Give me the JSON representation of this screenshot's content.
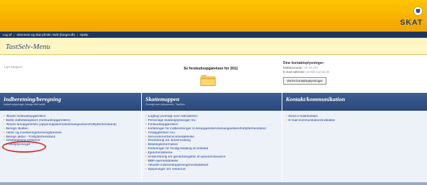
{
  "header": {
    "logo_text": "SKAT",
    "crown_icon": "crown-icon",
    "nav": [
      "Log af",
      "Abonnent og skat på Min Side (borger.dk)",
      "Hjælp"
    ]
  },
  "page_title": "TastSelv-Menu",
  "user": {
    "name": "Lars Mogens"
  },
  "forskud": {
    "label": "Se forskudsopgørelsen for 2011",
    "icon": "folder-icon"
  },
  "contact": {
    "heading": "Dine kontaktoplysninger:",
    "mobile_label": "Mobilnummer:",
    "mobile_value": "20 18 262",
    "email_label": "E-mail adresse:",
    "email_value": "post@mgmail.dk",
    "button_label": "Vis/ret kontaktoplysninger"
  },
  "columns": {
    "indberetning": {
      "title": "Indberetning/beregning",
      "subtitle": "Indtast oplysninger, beregn eller bestil",
      "items": [
        "Ændre forskudsopgørelsen",
        "Bestil indbetalingskort (forskudsopgørelsen)",
        "Ændre årsopgørelsen (oplysningsskemat/selvangivelsen/fraflytterhenstand)",
        "Beregn skatten",
        "Aktier og investeringsforeningsbeviser",
        "Beregn aktier - Fraflytterhenstand",
        "Selvbetjening restancer",
        "Profiloplysninger"
      ]
    },
    "skattemappen": {
      "title": "Skattemappen",
      "subtitle": "Oversigt over dokumenter i TastSelv",
      "items": [
        "Logbog (oversigt over hændelser)",
        "Personlige skatteoplysninger mv.",
        "Forskudsopgørelsen",
        "Kvitteringer for indberetninger til årsopgørelsen/selvangivelsen/fraflytterhenstand",
        "Årsopgørelsen mv.",
        "Servicebrev/Servicemeddelelse",
        "Orientering om seniorordning",
        "Betalingsinformation",
        "Kvitteringer for frivillig betaling af restskat",
        "Ejendomsskema",
        "Underretning om genanbringelse af ejendomsavance",
        "BBR-ejermeddelelse",
        "Aktuelle indkomstoplysninger/eSkattekort",
        "Oplysninger om restancer"
      ]
    },
    "kontakt": {
      "title": "Kontakt/kommunikation",
      "subtitle": "",
      "items": [
        "Send e-mail/kontakt",
        "E-mail kommunikation/indbakke"
      ]
    }
  },
  "colors": {
    "banner": "#f0a500",
    "navbar": "#1f3760",
    "column_header": "#2b4778",
    "column_body": "#edf1f8",
    "link": "#1c3c8f",
    "highlight_circle": "#d2362a"
  }
}
